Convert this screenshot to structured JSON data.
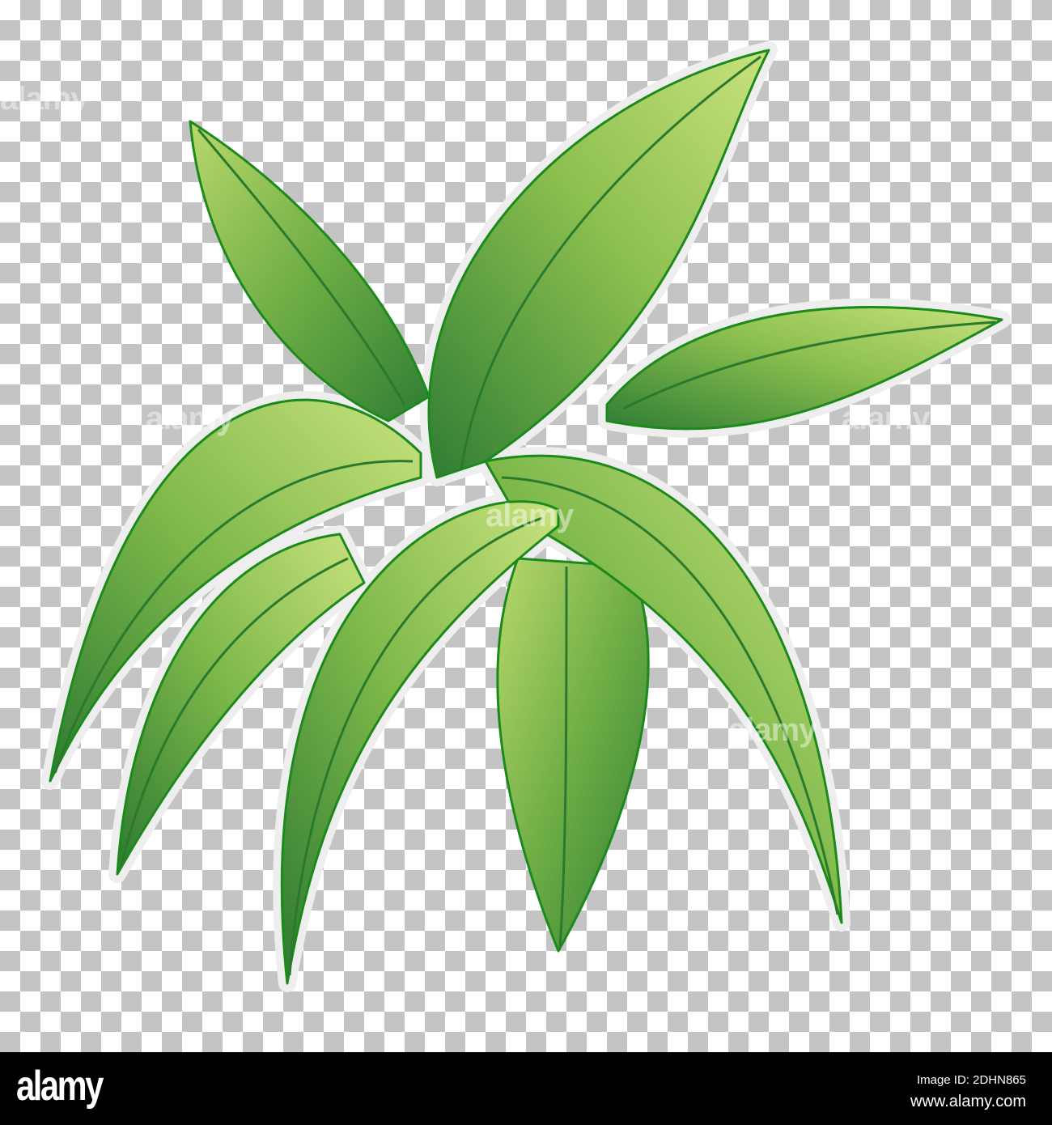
{
  "image": {
    "subject": "green leafy plant illustration",
    "background": "transparency checkerboard"
  },
  "watermark": {
    "text": "alamy"
  },
  "footer": {
    "logo": "alamy",
    "image_id": "Image ID: 2DHN865",
    "url": "www.alamy.com"
  },
  "colors": {
    "leaf_dark": "#2e7d32",
    "leaf_light": "#c9e27e",
    "outline": "#1b8a1b",
    "checker": "#c4c4c4",
    "bar": "#000000"
  }
}
